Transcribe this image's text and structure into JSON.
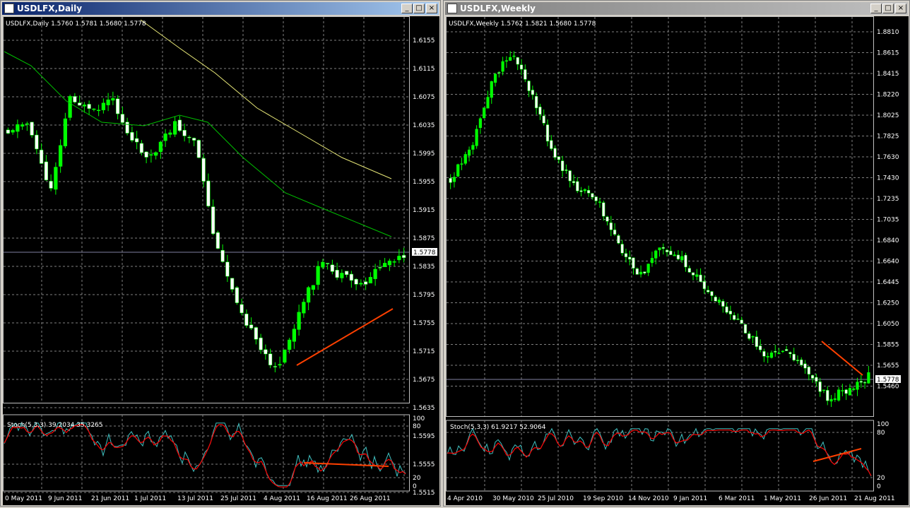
{
  "daily": {
    "window_title": "USDLFX,Daily",
    "info": "USDLFX,Daily  1.5760 1.5781 1.5680 1.5778",
    "price_box": "1.5778",
    "price_ticks": [
      "1.6155",
      "1.6115",
      "1.6075",
      "1.6035",
      "1.5995",
      "1.5955",
      "1.5915",
      "1.5875",
      "1.5835",
      "1.5795",
      "1.5755",
      "1.5715",
      "1.5675",
      "1.5635",
      "1.5595",
      "1.5555",
      "1.5515"
    ],
    "stoch_label": "Stoch(5,3,3) 39.2034 35.3265",
    "stoch_ticks": [
      "100",
      "80",
      "20",
      "0"
    ],
    "date_ticks": [
      "0 May 2011",
      "9 Jun 2011",
      "21 Jun 2011",
      "1 Jul 2011",
      "13 Jul 2011",
      "25 Jul 2011",
      "4 Aug 2011",
      "16 Aug 2011",
      "26 Aug 2011"
    ]
  },
  "weekly": {
    "window_title": "USDLFX,Weekly",
    "info": "USDLFX,Weekly  1.5762 1.5821 1.5680 1.5778",
    "price_box": "1.5778",
    "price_ticks": [
      "1.8810",
      "1.8615",
      "1.8415",
      "1.8220",
      "1.8025",
      "1.7825",
      "1.7630",
      "1.7430",
      "1.7235",
      "1.7035",
      "1.6840",
      "1.6640",
      "1.6445",
      "1.6250",
      "1.6050",
      "1.5855",
      "1.5655",
      "1.5460"
    ],
    "stoch_label": "Stoch(5,3,3) 61.9217 52.9064",
    "stoch_ticks": [
      "100",
      "80",
      "20",
      "0"
    ],
    "date_ticks": [
      "4 Apr 2010",
      "30 May 2010",
      "25 Jul 2010",
      "19 Sep 2010",
      "14 Nov 2010",
      "9 Jan 2011",
      "6 Mar 2011",
      "1 May 2011",
      "26 Jun 2011",
      "21 Aug 2011"
    ]
  },
  "colors": {
    "bull": "#00ff00",
    "bear": "#ffffff",
    "ma_fast": "#00c000",
    "ma_slow": "#e8e878",
    "trendline": "#ff4000",
    "stoch_main": "#40c0c0",
    "stoch_signal": "#ff0000",
    "grid": "#808080"
  },
  "icons": [
    "chart-window-icon",
    "minimize-icon",
    "maximize-icon",
    "close-icon"
  ]
}
